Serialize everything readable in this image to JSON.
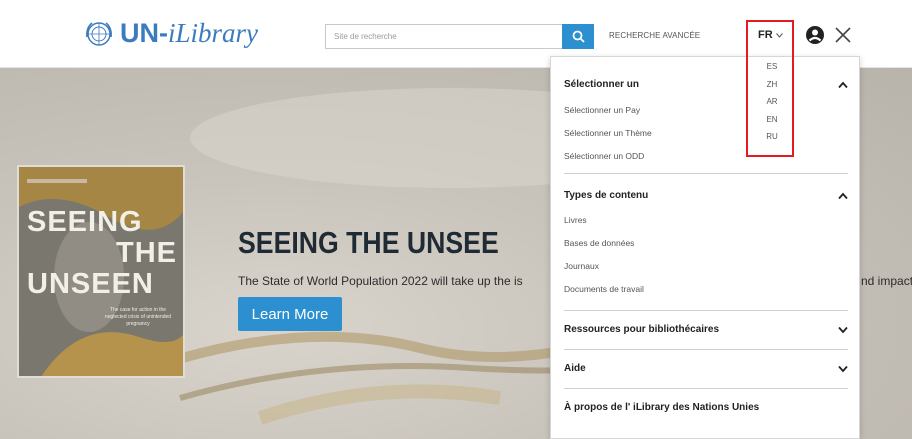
{
  "header": {
    "logo_text_bold": "UN-",
    "logo_text_italic": "iLibrary",
    "search_placeholder": "Site de recherche",
    "advanced_search": "RECHERCHE AVANCÉE",
    "current_language": "FR",
    "language_options": [
      "ES",
      "ZH",
      "AR",
      "EN",
      "RU"
    ]
  },
  "hero": {
    "book_cover": {
      "title_line1": "SEEING",
      "title_line2": "THE",
      "title_line3": "UNSEEN",
      "subtitle": "The case for action in the neglected crisis of unintended pregnancy"
    },
    "headline": "SEEING THE UNSEE",
    "description": "The State of World Population 2022 will take up the is",
    "description_tail": "nd impact",
    "button_label": "Learn More"
  },
  "menu": {
    "select_section": {
      "title": "Sélectionner un",
      "items": [
        "Sélectionner un Pay",
        "Sélectionner un Thème",
        "Sélectionner un ODD"
      ]
    },
    "content_types": {
      "title": "Types de contenu",
      "items": [
        "Livres",
        "Bases de données",
        "Journaux",
        "Documents de travail"
      ]
    },
    "librarian_resources": {
      "title": "Ressources pour bibliothécaires"
    },
    "help": {
      "title": "Aide"
    },
    "about": {
      "title": "À propos de l' iLibrary des Nations Unies"
    }
  },
  "colors": {
    "accent_blue": "#2b8fd0",
    "logo_blue": "#3d7bbf",
    "highlight_red": "#e31b23",
    "headline_dark": "#1f2a34"
  },
  "icons": [
    "un-emblem-icon",
    "search-icon",
    "chevron-down-icon",
    "user-icon",
    "close-icon",
    "chevron-up-icon"
  ]
}
